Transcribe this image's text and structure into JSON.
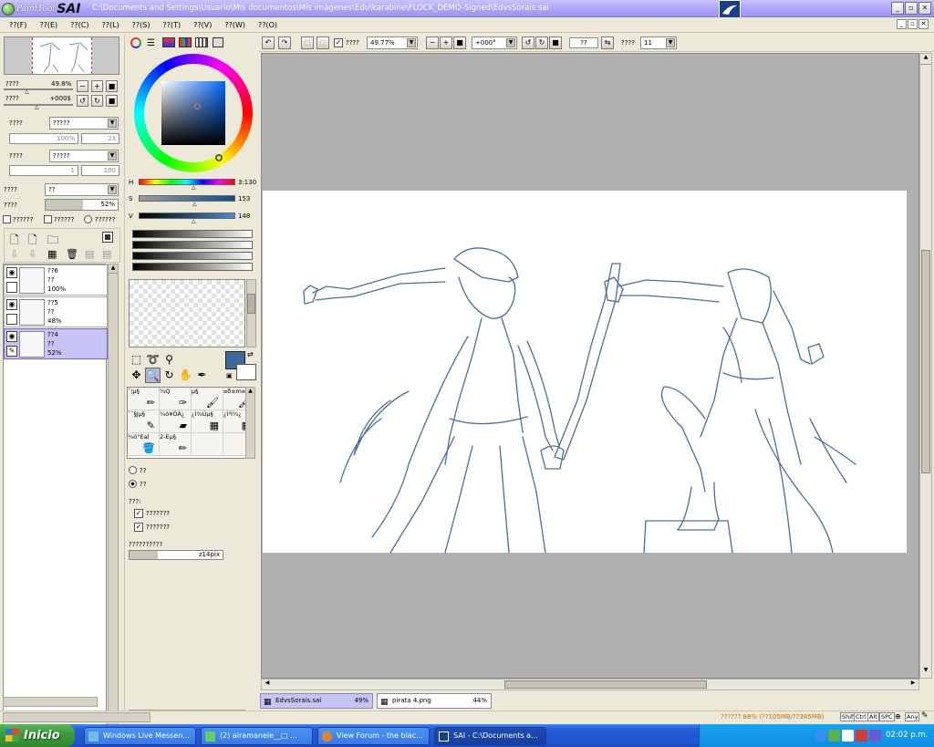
{
  "titlebar": {
    "app_name_small": "PaintTool",
    "app_name_big": "SAI",
    "title": "C:\\Documents and Settings\\Usuario\\Mis documentos\\Mis imágenes\\Edu\\karabine\\FLOCK_DEMO-Signed\\EdvsSorais.sai"
  },
  "menu": [
    "??(F)",
    "??(E)",
    "??(C)",
    "??(L)",
    "??(S)",
    "??(T)",
    "??(V)",
    "??(W)",
    "??(O)"
  ],
  "navigator": {
    "zoom_label": "????",
    "zoom_value": "49.8%",
    "angle_label": "????",
    "angle_value": "+000$"
  },
  "layer_props": {
    "mode_label": "????",
    "mode_value": "?????",
    "val1": "100%",
    "val2": "23",
    "texture_label": "????",
    "texture_value": "?????",
    "val3": "1",
    "val4": "100",
    "blend_label": "????",
    "blend_value": "??",
    "opacity_label": "????",
    "opacity_value": "52%",
    "opacity_fraction": 0.52,
    "check1": "??????",
    "check2": "??????",
    "radio1": "??????"
  },
  "layers": [
    {
      "name": "??6",
      "mode": "??",
      "opacity": "100%",
      "selected": false
    },
    {
      "name": "??5",
      "mode": "??",
      "opacity": "48%",
      "selected": false
    },
    {
      "name": "??4",
      "mode": "??",
      "opacity": "52%",
      "selected": true
    }
  ],
  "color": {
    "h_label": "H",
    "h_value": "3:130",
    "s_label": "S",
    "s_value": "153",
    "v_label": "V",
    "v_value": "148",
    "current": "#3e6a97"
  },
  "brushes": [
    {
      "label": "ˇ¦µ§"
    },
    {
      "label": "¾Q"
    },
    {
      "label": "µ§"
    },
    {
      "label": "¤ð±m¤µ§"
    },
    {
      "label": "ˇ¯§Jµ§"
    },
    {
      "label": "¾ó¥ÓÀ¿"
    },
    {
      "label": "¿Ì¾Úµ§"
    },
    {
      "label": "¿Ì³Ì¼¿"
    },
    {
      "label": "¾ó°Eal"
    },
    {
      "label": "2-Eµ§"
    },
    {
      "label": ""
    },
    {
      "label": ""
    }
  ],
  "brush_opts": {
    "radio1": "??",
    "radio2": "??",
    "section": "???:",
    "chk1": "???????",
    "chk2": "???????",
    "size_label": "??????????",
    "size_value": "z14pix",
    "size_fraction": 0.3
  },
  "toolbar": {
    "chk_label": "????",
    "zoom": "49.77%",
    "angle": "+000°",
    "flip": "??",
    "stab_label": "????",
    "stab_value": "11"
  },
  "tabs": [
    {
      "name": "EdvsSorais.sai",
      "zoom": "49%",
      "active": true
    },
    {
      "name": "pirata 4.png",
      "zoom": "44%",
      "active": false
    }
  ],
  "status": {
    "memory": "?????? 88% (??105MB/??385MB)",
    "keys": [
      "Shift",
      "Ctrl",
      "Alt",
      "SPC"
    ],
    "any": "Any"
  },
  "taskbar": {
    "start": "Inicio",
    "tasks": [
      "Windows Live Messen...",
      "(2) airamanele__□ ...",
      "View Forum - the blac...",
      "SAI - C:\\Documents a..."
    ],
    "clock": "02:02 p.m."
  }
}
